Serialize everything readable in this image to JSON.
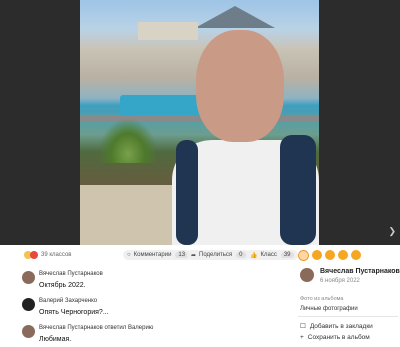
{
  "viewer": {
    "next_label": "Следующее фото"
  },
  "reactions": {
    "count_label": "39 классов"
  },
  "actions": {
    "comments": {
      "label": "Комментарии",
      "count": "13"
    },
    "share": {
      "label": "Поделиться",
      "count": "0"
    },
    "klass": {
      "label": "Класс",
      "count": "39"
    }
  },
  "comments": [
    {
      "author": "Вячеслав Пустарнаков",
      "text": "Октябрь 2022."
    },
    {
      "author": "Валерий Захарченко",
      "text": "Опять Черногория?..."
    },
    {
      "author": "Вячеслав Пустарнаков ответил Валерию",
      "text": "Любимая."
    }
  ],
  "sidebar": {
    "author": "Вячеслав Пустарнаков",
    "date": "6 ноября 2022",
    "album_caption": "Фото из альбома",
    "album_name": "Личные фотографии",
    "bookmark": "Добавить в закладки",
    "save": "Сохранить в альбом"
  },
  "colors": {
    "accent": "#f5a623",
    "viewer_bg": "#2c2c2c"
  }
}
